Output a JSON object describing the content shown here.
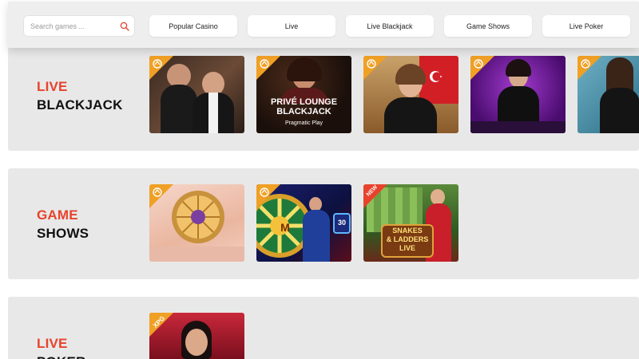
{
  "search": {
    "placeholder": "Search games ..."
  },
  "nav": {
    "items": [
      {
        "label": "Popular Casino"
      },
      {
        "label": "Live"
      },
      {
        "label": "Live Blackjack"
      },
      {
        "label": "Game Shows"
      },
      {
        "label": "Live Poker"
      }
    ]
  },
  "sections": [
    {
      "title_accent": "LIVE",
      "title_main": "BLACKJACK"
    },
    {
      "title_accent": "GAME",
      "title_main": "SHOWS"
    },
    {
      "title_accent": "LIVE",
      "title_main": "POKER"
    }
  ],
  "tiles": {
    "prive_title_line1": "PRIVÉ LOUNGE",
    "prive_title_line2": "BLACKJACK",
    "prive_provider": "Pragmatic Play",
    "wheel_letter": "M",
    "wheel_number": "30",
    "new_badge": "NEW",
    "snakes_line1": "SNAKES",
    "snakes_line2": "& LADDERS",
    "snakes_line3": "LIVE",
    "xpg_badge": "XPG"
  },
  "colors": {
    "accent": "#e8422c",
    "badge": "#f0a025",
    "section_bg": "#e8e8e8"
  }
}
